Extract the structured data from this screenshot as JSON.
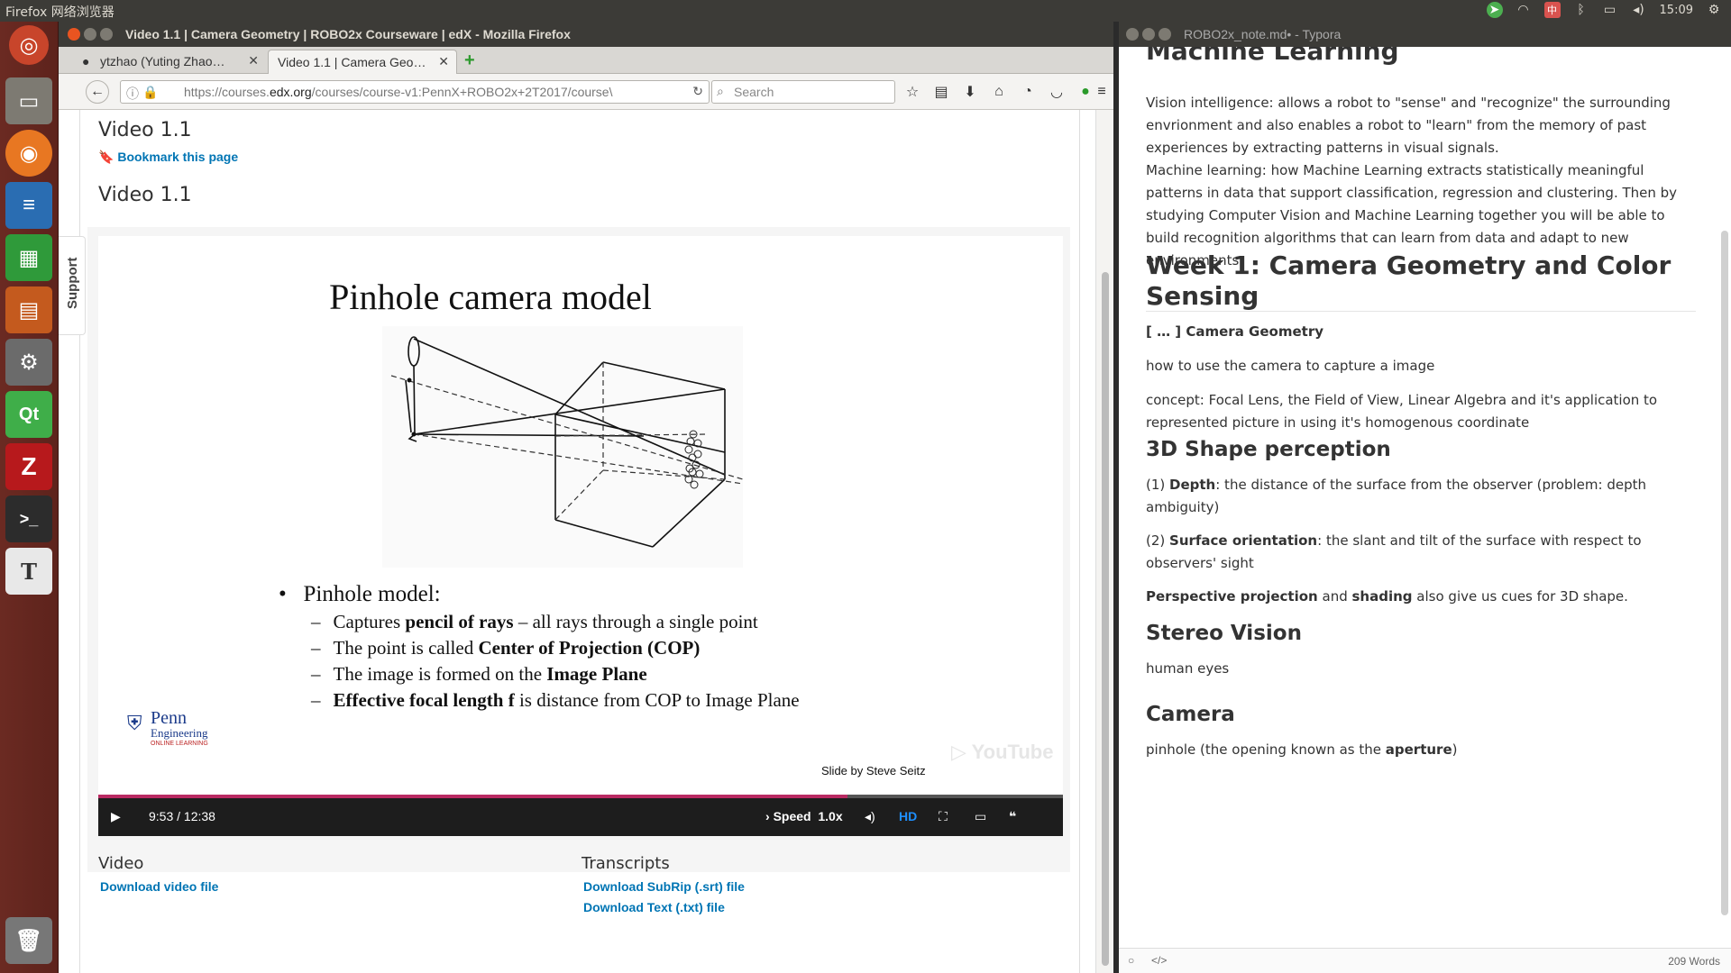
{
  "system": {
    "app_name": "Firefox 网络浏览器",
    "clock": "15:09"
  },
  "firefox": {
    "window_title": "Video 1.1 | Camera Geometry | ROBO2x Courseware | edX - Mozilla Firefox",
    "tabs": [
      {
        "label": "ytzhao (Yuting Zhao…"
      },
      {
        "label": "Video 1.1 | Camera Geo…"
      }
    ],
    "url_prefix": "https://courses.",
    "url_domain": "edx.org",
    "url_rest": "/courses/course-v1:PennX+ROBO2x+2T2017/course\\",
    "search_placeholder": "Search"
  },
  "page": {
    "support_label": "Support",
    "heading": "Video 1.1",
    "bookmark_label": "Bookmark this page",
    "video_heading": "Video 1.1",
    "slide": {
      "title": "Pinhole camera model",
      "bullet": "Pinhole model:",
      "sub_bullets": [
        {
          "pre": "Captures ",
          "bold": "pencil of rays",
          "post": " – all rays through a single point"
        },
        {
          "pre": "The point is called ",
          "bold": "Center of Projection (COP)",
          "post": ""
        },
        {
          "pre": "The image is formed on the ",
          "bold": "Image Plane",
          "post": ""
        },
        {
          "pre": "",
          "bold": "Effective focal length f",
          "post": " is distance from COP to Image Plane"
        }
      ],
      "penn_logo_line1": "Penn",
      "penn_logo_line2": "Engineering",
      "penn_logo_line3": "ONLINE LEARNING",
      "credit": "Slide by Steve Seitz",
      "watermark": "YouTube"
    },
    "player": {
      "time": "9:53 / 12:38",
      "progress": 0.777,
      "speed_label": "Speed",
      "speed_value": "1.0x",
      "hd_label": "HD"
    },
    "downloads": {
      "video_heading": "Video",
      "video_link": "Download video file",
      "transcripts_heading": "Transcripts",
      "srt_link": "Download SubRip (.srt) file",
      "txt_link": "Download Text (.txt) file"
    }
  },
  "typora": {
    "window_title": "ROBO2x_note.md• - Typora",
    "top_heading_partial": "Machine Learning",
    "p1": "Vision intelligence: allows a robot to \"sense\" and \"recognize\" the surrounding envrionment and also enables a robot to \"learn\" from the memory of past experiences by extracting patterns in visual signals.",
    "p2": "Machine learning: how Machine Learning extracts statistically meaningful patterns in data that support classification, regression and clustering. Then by studying Computer Vision and Machine Learning together you will be able to build recognition algorithms that can learn from data and adapt to new environments.",
    "h_week1": "Week 1: Camera Geometry and Color Sensing",
    "item_camera_geometry": "[ … ] Camera Geometry",
    "p_how": "how to use the camera to capture a image",
    "p_concept": "concept: Focal Lens, the Field of View, Linear Algebra and it's application to represented picture in using it's homogenous coordinate",
    "h_3d": "3D Shape perception",
    "depth_pre": "(1) ",
    "depth_bold": "Depth",
    "depth_rest": ": the distance of the surface from the observer (problem: depth ambiguity)",
    "orient_pre": "(2) ",
    "orient_bold": "Surface orientation",
    "orient_rest": ": the slant and tilt of the surface with respect to observers' sight",
    "persp_bold1": "Perspective projection",
    "persp_mid": " and ",
    "persp_bold2": "shading",
    "persp_rest": " also give us cues for 3D shape.",
    "h_stereo": "Stereo Vision",
    "p_stereo": "human eyes",
    "h_camera": "Camera",
    "pinhole_pre": "pinhole (the opening known as the ",
    "pinhole_bold": "aperture",
    "pinhole_post": ")",
    "word_count": "209 Words"
  }
}
